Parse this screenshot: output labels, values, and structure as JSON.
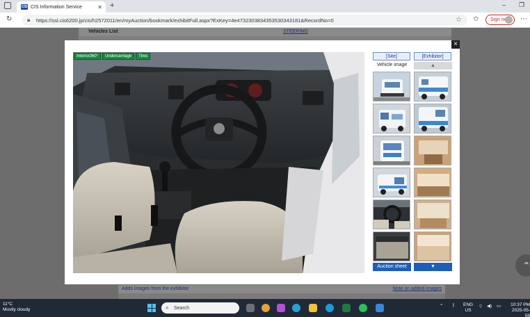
{
  "browser": {
    "tab_title": "CIS Information Service",
    "tab_favicon_text": "CIS",
    "url": "https://ssl.cis6200.jp/cis/h2572011/en/myAuction/bookmark/exhibitFull.aspx?ExKey=4e4732303834353530343181&RecordNo=0",
    "signin_label": "Sign in",
    "new_tab_symbol": "+"
  },
  "background_page": {
    "header_left": "Vehicles List",
    "header_link": "STEERING",
    "bottom_left": "Adds images from the exhibitor",
    "bottom_link": "Note on added images"
  },
  "modal": {
    "close_symbol": "×",
    "photo_tags": [
      "Interior360°",
      "Undercarriage",
      "Tires"
    ],
    "site_tab": "[Site]",
    "exhibitor_tab": "[Exhibitor]",
    "vehicle_image_label": "Vehicle image",
    "scroll_up_symbol": "▲",
    "scroll_down_symbol": "▼",
    "auction_sheet_label": "Auction sheet",
    "site_thumbnails": [
      "Front exterior",
      "Side exterior",
      "Rear exterior",
      "Side view",
      "Interior dashboard",
      "Interior seats"
    ],
    "exhibitor_thumbnails": [
      "Camper exterior",
      "Camper side",
      "Camper cabin",
      "Camper interior",
      "Camper bed",
      "Camper floor"
    ]
  },
  "taskbar": {
    "weather_temp": "11°C",
    "weather_text": "Mostly cloudy",
    "search_placeholder": "Search",
    "lang_top": "ENG",
    "lang_bottom": "US",
    "time": "10:37 PM",
    "date": "2025-05-08"
  },
  "colors": {
    "tag_green": "#1a8a3c",
    "button_blue": "#1e5eb8",
    "link_blue": "#1c3f9c"
  }
}
